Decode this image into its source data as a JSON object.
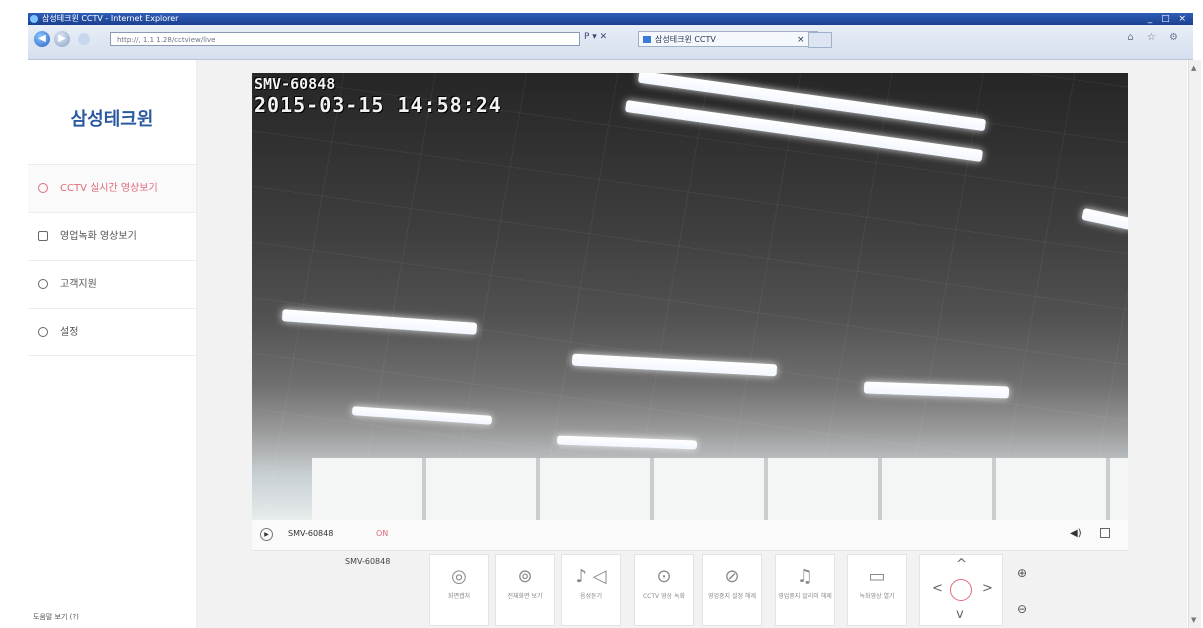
{
  "browser": {
    "title": "삼성테크윈 CCTV - Internet Explorer",
    "window_controls": "_ □ ×",
    "address": "http://, 1.1 1.28/cctview/live",
    "address_controls": "P ▾ ✕",
    "tab_title": "삼성테크윈 CCTV",
    "tab_close": "×",
    "right_tools": "⌂ ☆ ⚙"
  },
  "sidebar": {
    "brand": "삼성테크윈",
    "items": [
      {
        "label": "CCTV 실시간 영상보기",
        "active": true
      },
      {
        "label": "영업녹화 영상보기",
        "active": false
      },
      {
        "label": "고객지원",
        "active": false
      },
      {
        "label": "설정",
        "active": false
      }
    ],
    "footer": "도움말 보기 (?)"
  },
  "video": {
    "camera_name": "SMV-60848",
    "timestamp": "2015-03-15 14:58:24",
    "model": "SMV-60848",
    "status": "ON",
    "play_icon": "▶",
    "volume_icon": "◀)",
    "fullscreen_icon": "fullscreen-icon"
  },
  "controls": {
    "device_label": "SMV-60848",
    "buttons": [
      {
        "icon": "◎",
        "label": "화면캡처"
      },
      {
        "icon": "⊚",
        "label": "전체화면 보기"
      },
      {
        "icon": "♪ ◁",
        "label": "음성듣기"
      },
      {
        "icon": "⊙",
        "label": "CCTV 영상 녹화"
      },
      {
        "icon": "⊘",
        "label": "영업중지 설정 해제"
      },
      {
        "icon": "♫",
        "label": "영업중지 알리미 해제"
      },
      {
        "icon": "▭",
        "label": "녹화영상 열기"
      }
    ],
    "ptz": {
      "up": "^",
      "down": "v",
      "left": "<",
      "right": ">"
    },
    "zoom_in": "⊕",
    "zoom_out": "⊖"
  },
  "colors": {
    "accent": "#e06a7a",
    "brand": "#2c5aa0"
  }
}
